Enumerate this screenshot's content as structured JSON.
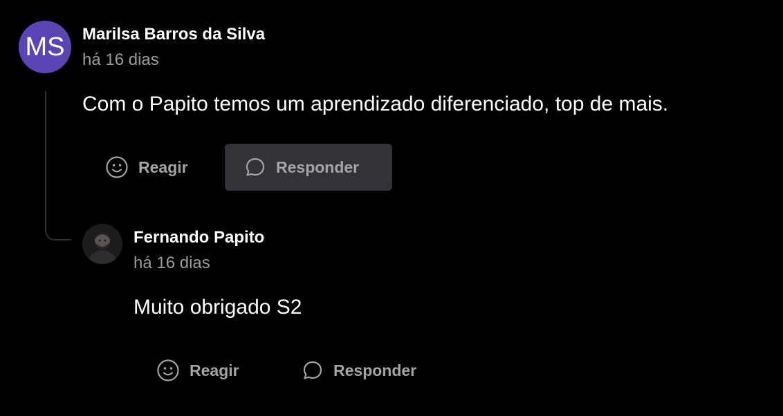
{
  "comment": {
    "avatar_initials": "MS",
    "avatar_color": "#5b45b5",
    "author": "Marilsa Barros da Silva",
    "time": "há 16 dias",
    "text": "Com o Papito temos um aprendizado diferenciado, top de mais.",
    "react_label": "Reagir",
    "reply_label": "Responder"
  },
  "reply": {
    "author": "Fernando Papito",
    "time": "há 16 dias",
    "text": "Muito obrigado S2",
    "react_label": "Reagir",
    "reply_label": "Responder"
  },
  "icons": {
    "react": "smiley-icon",
    "reply": "chat-bubble-icon"
  }
}
